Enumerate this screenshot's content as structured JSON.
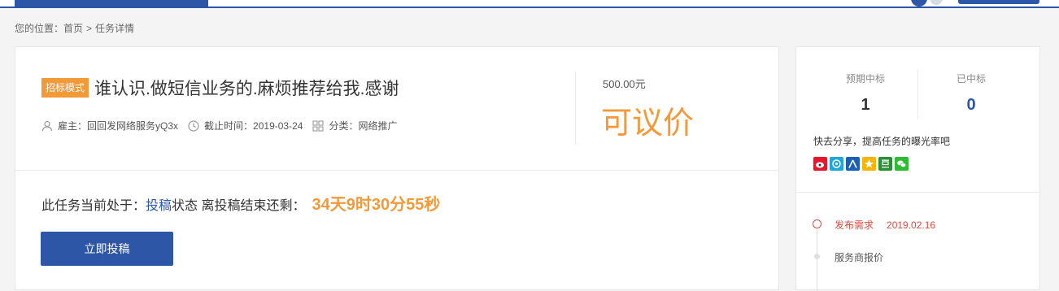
{
  "breadcrumb": {
    "prefix": "您的位置：",
    "home": "首页",
    "separator": ">",
    "current": "任务详情"
  },
  "task": {
    "mode_badge": "招标模式",
    "title": "谁认识.做短信业务的.麻烦推荐给我.感谢",
    "employer_label": "雇主：",
    "employer": "回回发网络服务yQ3x",
    "deadline_label": "截止时间：",
    "deadline": "2019-03-24",
    "category_label": "分类：",
    "category": "网络推广",
    "budget_amount": "500.00元",
    "budget_note": "可议价"
  },
  "status": {
    "prefix": "此任务当前处于：",
    "stage_link": "投稿",
    "suffix": "状态 离投稿结束还剩：",
    "countdown": "34天9时30分55秒",
    "submit_label": "立即投稿"
  },
  "stats": {
    "expected_label": "预期中标",
    "expected_value": "1",
    "won_label": "已中标",
    "won_value": "0"
  },
  "share": {
    "text": "快去分享，提高任务的曝光率吧",
    "icons": [
      "weibo-icon",
      "tencent-weibo-icon",
      "renren-icon",
      "qzone-icon",
      "douban-icon",
      "wechat-icon"
    ]
  },
  "timeline": [
    {
      "label": "发布需求",
      "date": "2019.02.16"
    },
    {
      "label": "服务商报价"
    }
  ],
  "colors": {
    "primary": "#2e56a6",
    "accent": "#f29a38",
    "timeline_active": "#e0483b"
  }
}
